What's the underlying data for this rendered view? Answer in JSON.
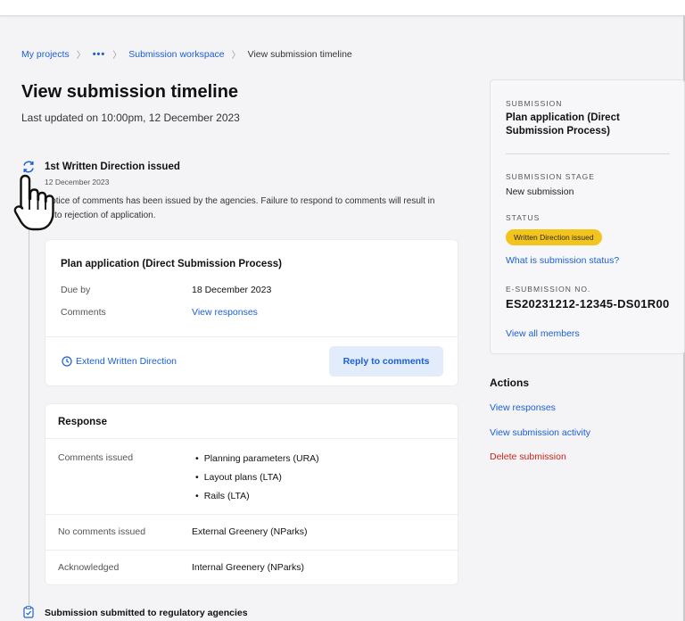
{
  "breadcrumb": {
    "my_projects": "My projects",
    "ellipsis": "•••",
    "workspace": "Submission workspace",
    "current": "View submission timeline"
  },
  "page": {
    "title": "View submission timeline",
    "updated": "Last updated on 10:00pm, 12 December 2023"
  },
  "timeline": {
    "event1": {
      "title": "1st Written Direction issued",
      "date": "12 December 2023",
      "desc": "Notice of comments has been issued by the agencies. Failure to respond to comments will result in auto rejection of application."
    },
    "card": {
      "title": "Plan application (Direct Submission Process)",
      "due_label": "Due by",
      "due_value": "18 December 2023",
      "comments_label": "Comments",
      "comments_link": "View responses",
      "extend": "Extend Written Direction",
      "reply": "Reply to comments"
    },
    "response": {
      "title": "Response",
      "comments_issued_label": "Comments issued",
      "comments_issued": [
        "Planning parameters (URA)",
        "Layout plans (LTA)",
        "Rails (LTA)"
      ],
      "no_comments_label": "No comments issued",
      "no_comments_value": "External Greenery (NParks)",
      "acknowledged_label": "Acknowledged",
      "acknowledged_value": "Internal Greenery (NParks)"
    },
    "event2": {
      "title": "Submission submitted to regulatory agencies"
    }
  },
  "side": {
    "submission_label": "SUBMISSION",
    "submission_value": "Plan application (Direct Submission Process)",
    "stage_label": "SUBMISSION STAGE",
    "stage_value": "New submission",
    "status_label": "STATUS",
    "status_badge": "Written Direction issued",
    "status_link": "What is submission status?",
    "esub_label": "E-SUBMISSION NO.",
    "esub_value": "ES20231212-12345-DS01R00",
    "members_link": "View all members"
  },
  "actions": {
    "title": "Actions",
    "view_responses": "View responses",
    "view_activity": "View submission activity",
    "delete": "Delete submission"
  },
  "colors": {
    "link": "#1a5fd6",
    "badge": "#f3c51c",
    "danger": "#d0211a",
    "background": "#f4f4f6"
  },
  "icons": [
    "sync-icon",
    "clock-icon",
    "clipboard-check-icon",
    "hand-pointer-icon"
  ]
}
